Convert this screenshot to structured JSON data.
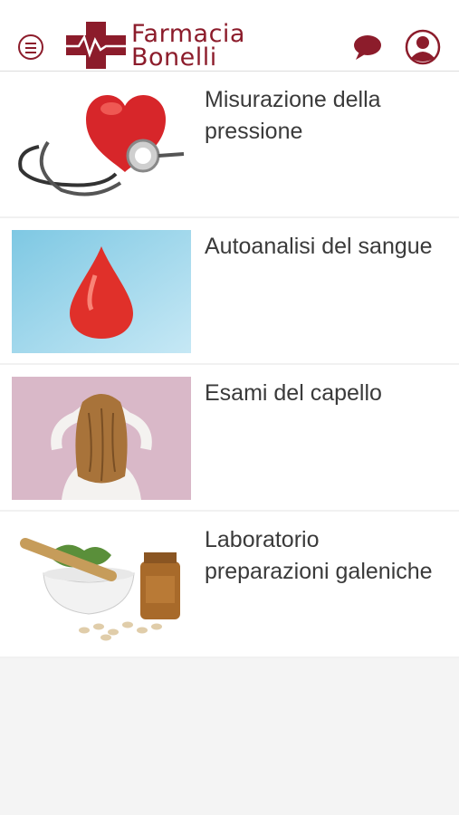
{
  "header": {
    "menu_icon": "hamburger-menu-icon",
    "logo_line1": "Farmacia",
    "logo_line2": "Bonelli",
    "brand_color": "#8c1c2b",
    "chat_icon": "chat-bubble-icon",
    "user_icon": "user-profile-icon"
  },
  "services": [
    {
      "title": "Misurazione della pressione",
      "image": "heart-stethoscope-image"
    },
    {
      "title": "Autoanalisi del sangue",
      "image": "blood-drop-image"
    },
    {
      "title": "Esami del capello",
      "image": "hair-woman-image"
    },
    {
      "title": "Laboratorio preparazioni galeniche",
      "image": "mortar-pills-image"
    }
  ]
}
